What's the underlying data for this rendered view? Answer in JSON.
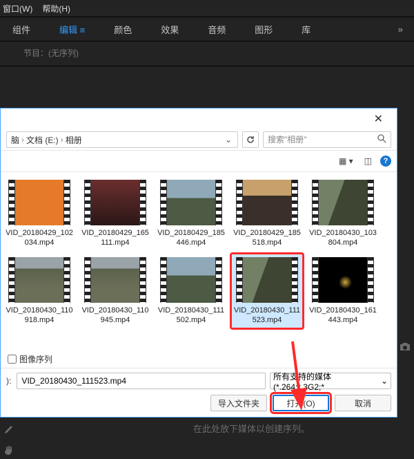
{
  "host": {
    "menubar": {
      "window": "窗口(W)",
      "help": "帮助(H)"
    },
    "tabs": {
      "component": "组件",
      "edit": "编辑",
      "color": "颜色",
      "effect": "效果",
      "audio": "音频",
      "graphic": "图形",
      "library": "库",
      "more": "»"
    },
    "program_label": "节目：(无序列)",
    "hint": "在此处放下媒体以创建序列。"
  },
  "dialog": {
    "breadcrumb": {
      "item1": "脑",
      "item2": "文档 (E:)",
      "item3": "相册"
    },
    "search_placeholder": "搜索\"相册\"",
    "view_labels": {
      "view": "▦ ▾",
      "preview": "◫"
    },
    "files": [
      {
        "label": "VID_20180429_102034.mp4",
        "thumb": "play"
      },
      {
        "label": "VID_20180429_165111.mp4",
        "thumb": "red"
      },
      {
        "label": "VID_20180429_185446.mp4",
        "thumb": "sky"
      },
      {
        "label": "VID_20180429_185518.mp4",
        "thumb": "sunset"
      },
      {
        "label": "VID_20180430_103804.mp4",
        "thumb": "cliff"
      },
      {
        "label": "VID_20180430_110918.mp4",
        "thumb": "rock"
      },
      {
        "label": "VID_20180430_110945.mp4",
        "thumb": "rock"
      },
      {
        "label": "VID_20180430_111502.mp4",
        "thumb": "sky"
      },
      {
        "label": "VID_20180430_111523.mp4",
        "thumb": "cliff",
        "selected": true,
        "highlighted": true
      },
      {
        "label": "VID_20180430_161443.mp4",
        "thumb": "dark"
      }
    ],
    "image_sequence_label": "图像序列",
    "filename_label": "):",
    "filename_value": "VID_20180430_111523.mp4",
    "filter_label": "所有支持的媒体 (*.264;*.3G2;*",
    "buttons": {
      "import_folder": "导入文件夹",
      "open": "打开(O)",
      "cancel": "取消"
    }
  }
}
